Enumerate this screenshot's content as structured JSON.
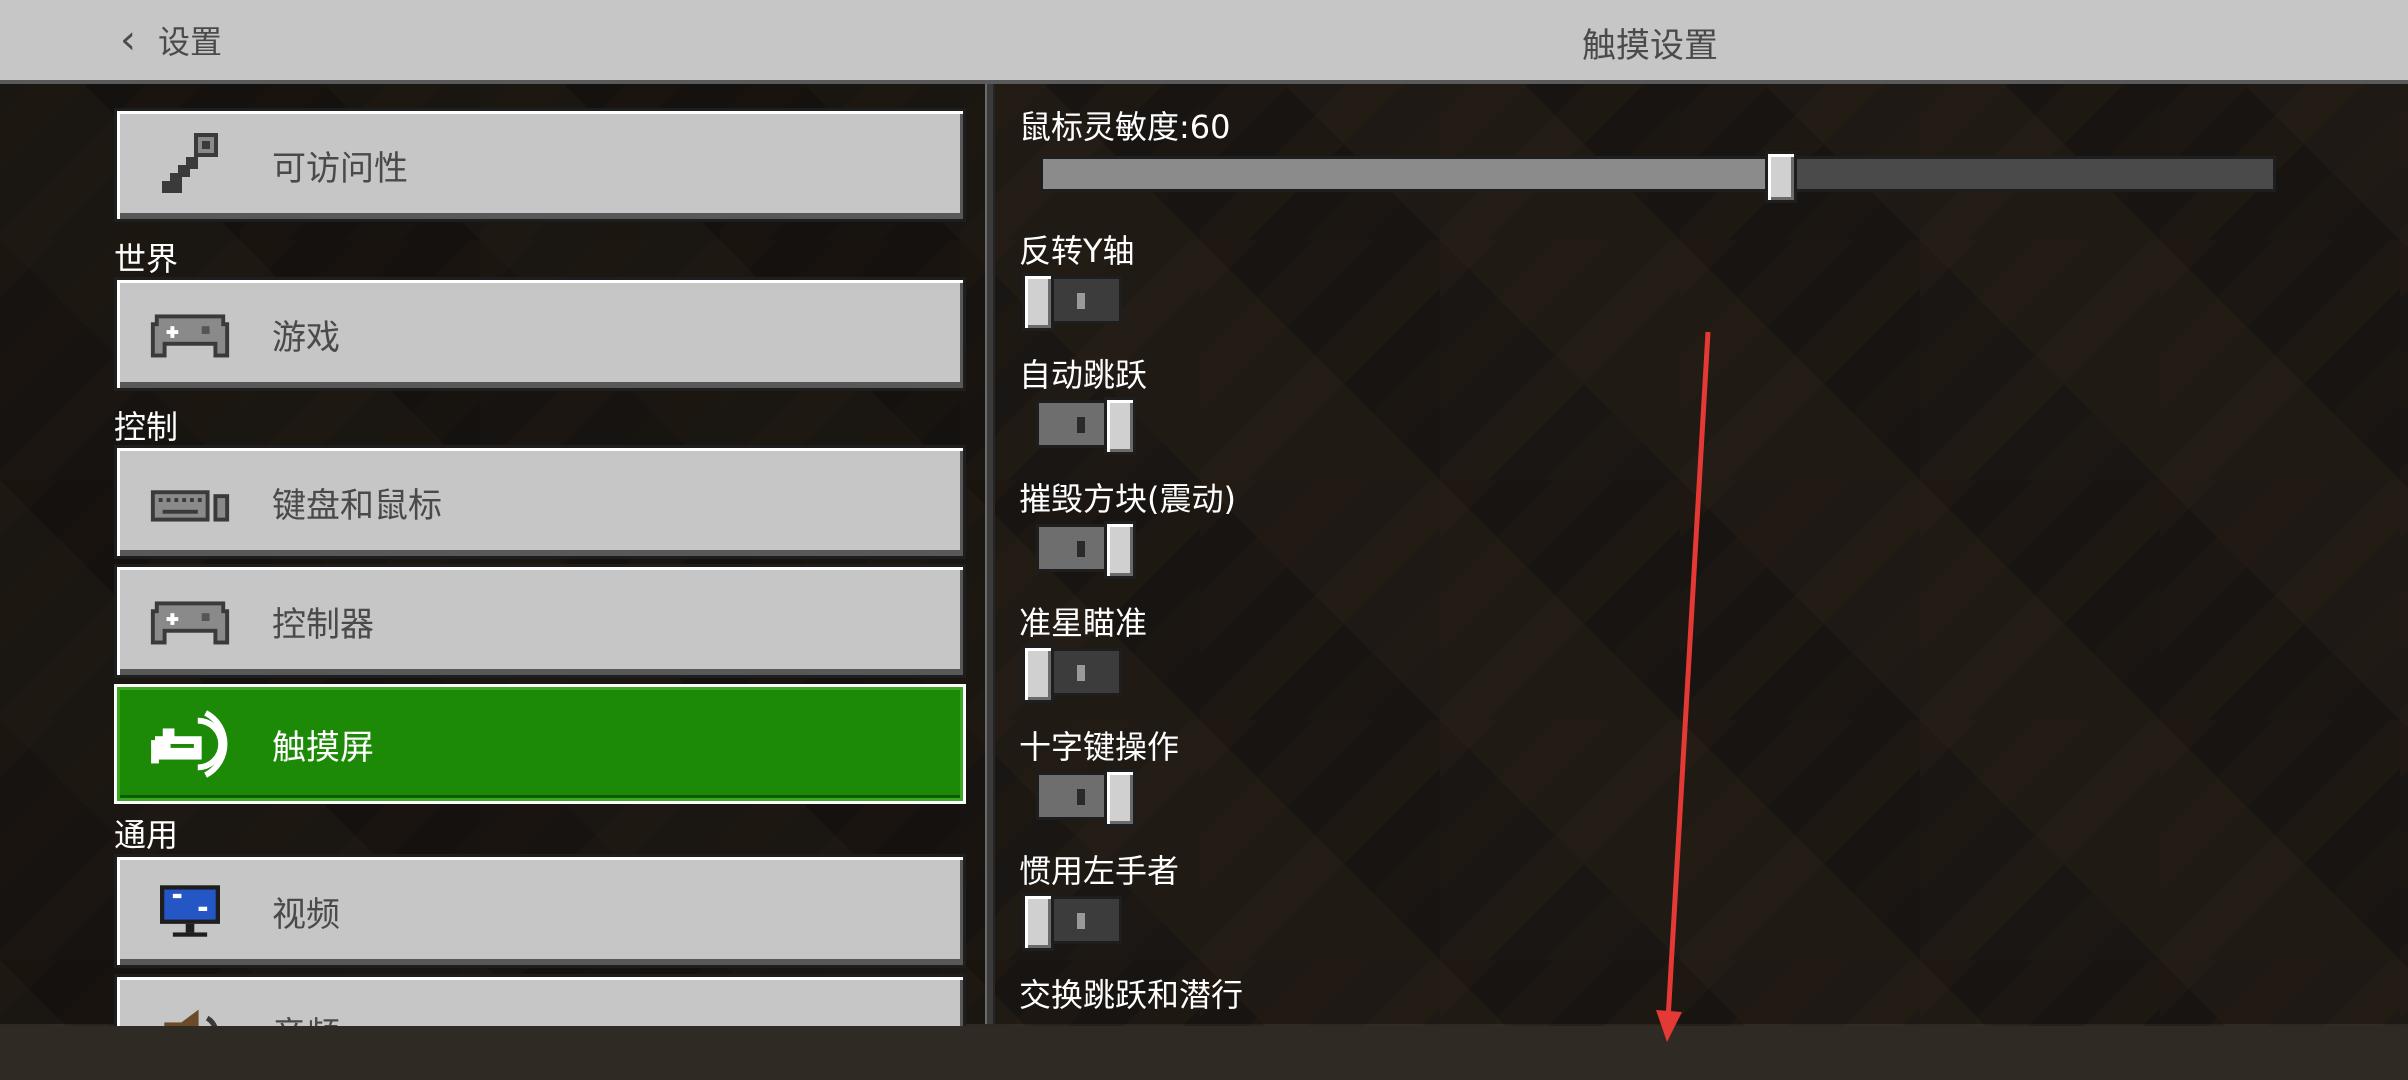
{
  "header": {
    "back_label": "设置",
    "title": "触摸设置"
  },
  "sidebar": {
    "items": [
      {
        "label": "可访问性",
        "icon": "key-icon"
      },
      {
        "section": "世界"
      },
      {
        "label": "游戏",
        "icon": "gamepad-icon"
      },
      {
        "section": "控制"
      },
      {
        "label": "键盘和鼠标",
        "icon": "keyboard-mouse-icon"
      },
      {
        "label": "控制器",
        "icon": "gamepad-icon"
      },
      {
        "label": "触摸屏",
        "icon": "touch-icon",
        "active": true
      },
      {
        "section": "通用"
      },
      {
        "label": "视频",
        "icon": "monitor-icon"
      },
      {
        "label": "音频",
        "icon": "speaker-icon"
      }
    ]
  },
  "settings": {
    "sensitivity": {
      "label": "鼠标灵敏度:60",
      "value": 60,
      "max": 100
    },
    "toggles": [
      {
        "label": "反转Y轴",
        "on": false
      },
      {
        "label": "自动跳跃",
        "on": true
      },
      {
        "label": "摧毁方块(震动)",
        "on": true
      },
      {
        "label": "准星瞄准",
        "on": false
      },
      {
        "label": "十字键操作",
        "on": true
      },
      {
        "label": "惯用左手者",
        "on": false
      },
      {
        "label": "交换跳跃和潜行",
        "on": false
      }
    ]
  },
  "colors": {
    "active_green": "#1d8a07",
    "button_gray": "#c6c6c6",
    "annotation_arrow": "#e53935"
  }
}
